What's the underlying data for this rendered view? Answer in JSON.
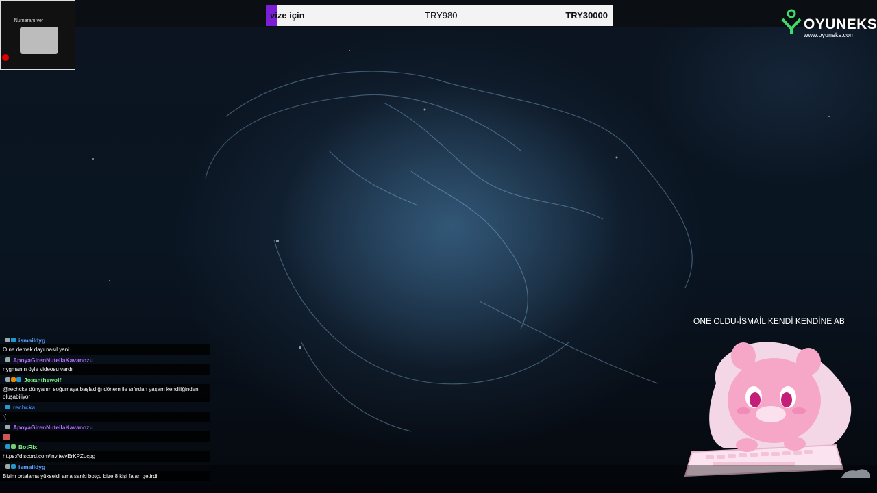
{
  "webcam": {
    "label": "Numaranı ver"
  },
  "ticker": {
    "left": "vize için",
    "middle": "TRY980",
    "right": "TRY30000",
    "accent_color": "#7a1fd6"
  },
  "logo": {
    "brand": "OYUNEKS",
    "url": "www.oyuneks.com",
    "icon": "oyuneks-logo-icon"
  },
  "marquee": {
    "text": "ONE OLDU-İSMAİL KENDİ KENDİNE ABO"
  },
  "chat": {
    "messages": [
      {
        "user": "ismaildyg",
        "color": "#5aa0ff",
        "text": "O ne demek dayı nasıl yani"
      },
      {
        "user": "ApoyaGirenNutellaKavanozu",
        "color": "#b36bff",
        "text": "nygmanın öyle videosu vardı"
      },
      {
        "user": "Joaanthewolf",
        "color": "#7cf07c",
        "text": "@rechcka dünyanın soğumaya başladığı dönem ile sıfırdan yaşam kendiliğinden oluşabiliyor"
      },
      {
        "user": "rechcka",
        "color": "#3f8fff",
        "text": ":("
      },
      {
        "user": "ApoyaGirenNutellaKavanozu",
        "color": "#b36bff",
        "text": ""
      },
      {
        "user": "BotRix",
        "color": "#7cf07c",
        "text": "https://discord.com/invite/vErKPZucpg"
      },
      {
        "user": "ismaildyg",
        "color": "#5aa0ff",
        "text": "Bizim ortalama yükseldi ama sanki botçu bize 8 kişi falan getirdi"
      }
    ]
  }
}
